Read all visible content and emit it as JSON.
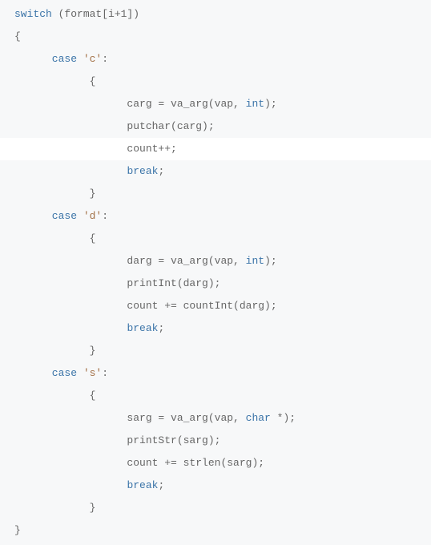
{
  "code": {
    "line01_switch": "switch",
    "line01_rest": " (format[i+1])",
    "line02": "{",
    "line03_case": "      case",
    "line03_str": " 'c'",
    "line03_colon": ":",
    "line04": "            {",
    "line05a": "                  carg = va_arg(vap, ",
    "line05_int": "int",
    "line05b": ");",
    "line06": "                  putchar(carg);",
    "line07": "                  count++;",
    "line08_indent": "                  ",
    "line08_break": "break",
    "line08_semi": ";",
    "line09": "            }",
    "line10_case": "      case",
    "line10_str": " 'd'",
    "line10_colon": ":",
    "line11": "            {",
    "line12a": "                  darg = va_arg(vap, ",
    "line12_int": "int",
    "line12b": ");",
    "line13": "                  printInt(darg);",
    "line14": "                  count += countInt(darg);",
    "line15_indent": "                  ",
    "line15_break": "break",
    "line15_semi": ";",
    "line16": "            }",
    "line17_case": "      case",
    "line17_str": " 's'",
    "line17_colon": ":",
    "line18": "            {",
    "line19a": "                  sarg = va_arg(vap, ",
    "line19_char": "char",
    "line19b": " *);",
    "line20": "                  printStr(sarg);",
    "line21": "                  count += strlen(sarg);",
    "line22_indent": "                  ",
    "line22_break": "break",
    "line22_semi": ";",
    "line23": "            }",
    "line24": "}"
  }
}
